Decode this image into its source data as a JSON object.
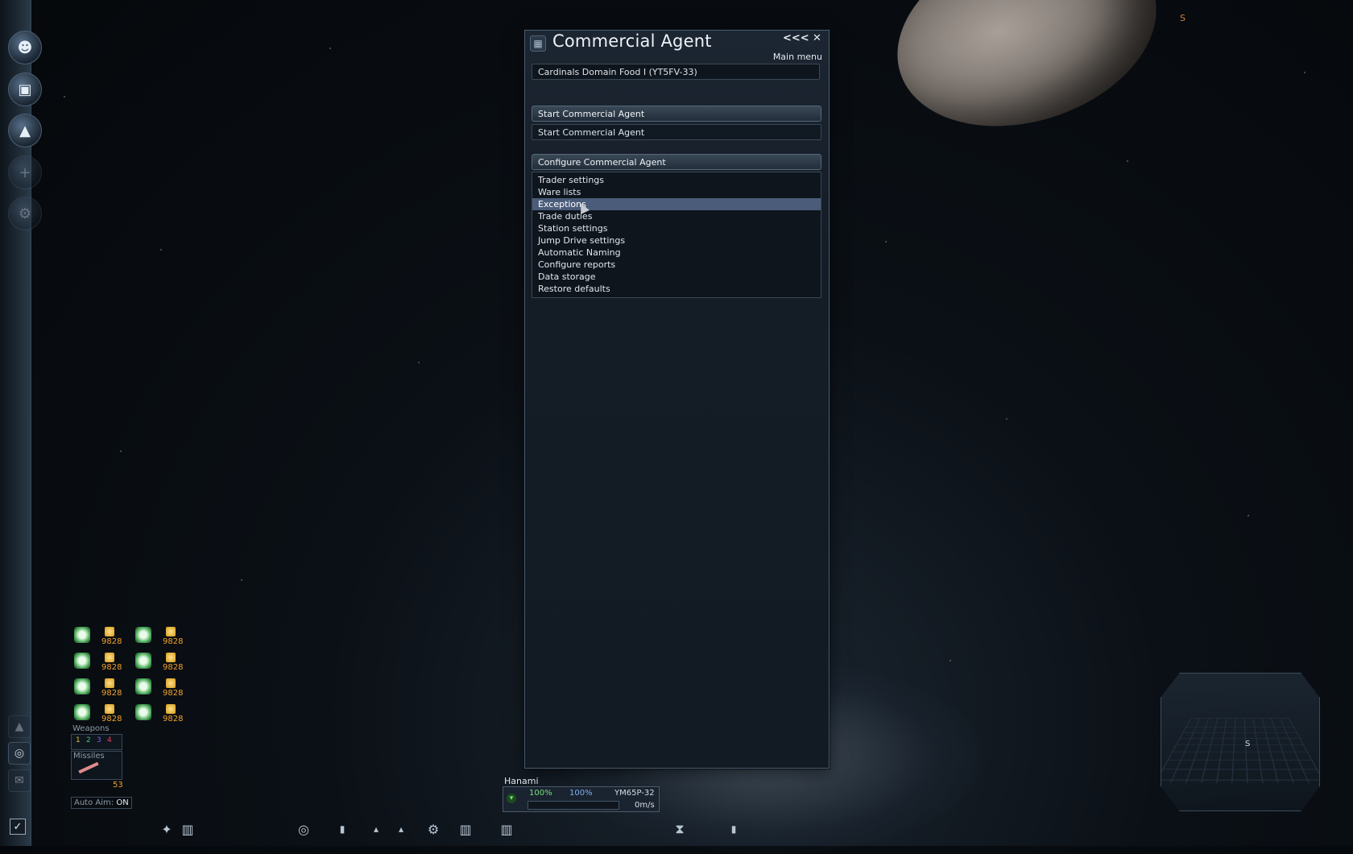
{
  "window": {
    "title": "Commercial Agent",
    "collapse_label": "<<<",
    "close_label": "✕",
    "menu_label": "Main menu"
  },
  "ship_field": "Cardinals Domain Food I (YT5FV-33)",
  "start_section": {
    "header": "Start Commercial Agent",
    "button": "Start Commercial Agent"
  },
  "configure_section": {
    "header": "Configure Commercial Agent",
    "items": [
      {
        "label": "Trader settings",
        "selected": false
      },
      {
        "label": "Ware lists",
        "selected": false
      },
      {
        "label": "Exceptions",
        "selected": true
      },
      {
        "label": "Trade duties",
        "selected": false
      },
      {
        "label": "Station settings",
        "selected": false
      },
      {
        "label": "Jump Drive settings",
        "selected": false
      },
      {
        "label": "Automatic Naming",
        "selected": false
      },
      {
        "label": "Configure reports",
        "selected": false
      },
      {
        "label": "Data storage",
        "selected": false
      },
      {
        "label": "Restore defaults",
        "selected": false
      }
    ]
  },
  "hud": {
    "cargo_values": [
      "9828",
      "9828",
      "9828",
      "9828",
      "9828",
      "9828",
      "9828",
      "9828"
    ],
    "weapons_label": "Weapons",
    "weapon_slots": [
      "1",
      "2",
      "3",
      "4"
    ],
    "missiles_label": "Missiles",
    "missile_count": "53",
    "auto_aim_label": "Auto Aim:",
    "auto_aim_value": "ON"
  },
  "ship_status": {
    "name": "Hanami",
    "hull": "100%",
    "shield": "100%",
    "ship_id": "YM65P-32",
    "speed": "0m/s"
  },
  "moon_marker": "S",
  "minimap_marker": "S",
  "colors": {
    "panel_bg": "#141c26",
    "selected_row": "#4b5c7a",
    "cargo_value": "#f0a12c",
    "hull_green": "#76e07a",
    "shield_blue": "#7fb0f0"
  },
  "icons": {
    "leftbar": [
      "pilot-icon",
      "camera-icon",
      "eject-icon",
      "add-icon",
      "settings-icon"
    ],
    "toolbar": [
      "weapon-icon",
      "compass-icon",
      "drone-icon",
      "cargo-icon",
      "beacon-icon"
    ]
  }
}
